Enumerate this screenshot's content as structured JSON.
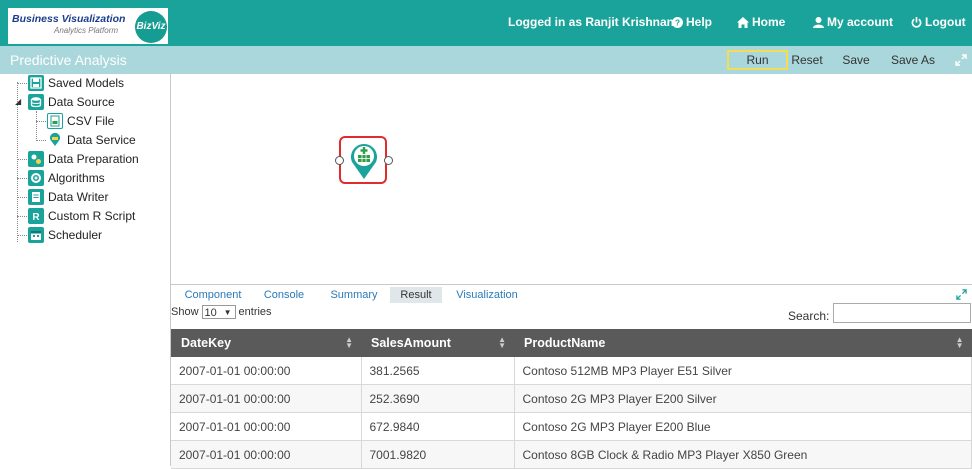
{
  "header": {
    "logo_title": "Business Visualization",
    "logo_subtitle": "Analytics Platform",
    "logo_badge": "BizViz",
    "logged_in_text": "Logged in as Ranjit Krishnan",
    "help_label": "Help",
    "home_label": "Home",
    "account_label": "My account",
    "logout_label": "Logout"
  },
  "titlebar": {
    "title": "Predictive Analysis",
    "run_label": "Run",
    "reset_label": "Reset",
    "save_label": "Save",
    "save_as_label": "Save As"
  },
  "sidebar": {
    "items": [
      {
        "label": "Saved Models",
        "icon": "saved-models-icon"
      },
      {
        "label": "Data Source",
        "icon": "data-source-icon"
      },
      {
        "label": "CSV File",
        "icon": "csv-file-icon"
      },
      {
        "label": "Data Service",
        "icon": "data-service-icon"
      },
      {
        "label": "Data Preparation",
        "icon": "data-preparation-icon"
      },
      {
        "label": "Algorithms",
        "icon": "algorithms-icon"
      },
      {
        "label": "Data Writer",
        "icon": "data-writer-icon"
      },
      {
        "label": "Custom R Script",
        "icon": "custom-r-script-icon"
      },
      {
        "label": "Scheduler",
        "icon": "scheduler-icon"
      }
    ]
  },
  "bottom_panel": {
    "tabs": [
      "Component",
      "Console",
      "Summary",
      "Result",
      "Visualization"
    ],
    "active_tab": "Result",
    "show_label": "Show",
    "entries_value": "10",
    "entries_label": "entries",
    "search_label": "Search:",
    "search_value": ""
  },
  "table": {
    "columns": [
      "DateKey",
      "SalesAmount",
      "ProductName"
    ],
    "rows": [
      [
        "2007-01-01 00:00:00",
        "381.2565",
        "Contoso 512MB MP3 Player E51 Silver"
      ],
      [
        "2007-01-01 00:00:00",
        "252.3690",
        "Contoso 2G MP3 Player E200 Silver"
      ],
      [
        "2007-01-01 00:00:00",
        "672.9840",
        "Contoso 2G MP3 Player E200 Blue"
      ],
      [
        "2007-01-01 00:00:00",
        "7001.9820",
        "Contoso 8GB Clock & Radio MP3 Player X850 Green"
      ]
    ]
  },
  "colors": {
    "header_bg": "#1aa39a",
    "titlebar_bg": "#a9d7db",
    "table_header_bg": "#5a5a5a",
    "node_border": "#e02c2c",
    "icon_teal": "#1aa39a"
  }
}
